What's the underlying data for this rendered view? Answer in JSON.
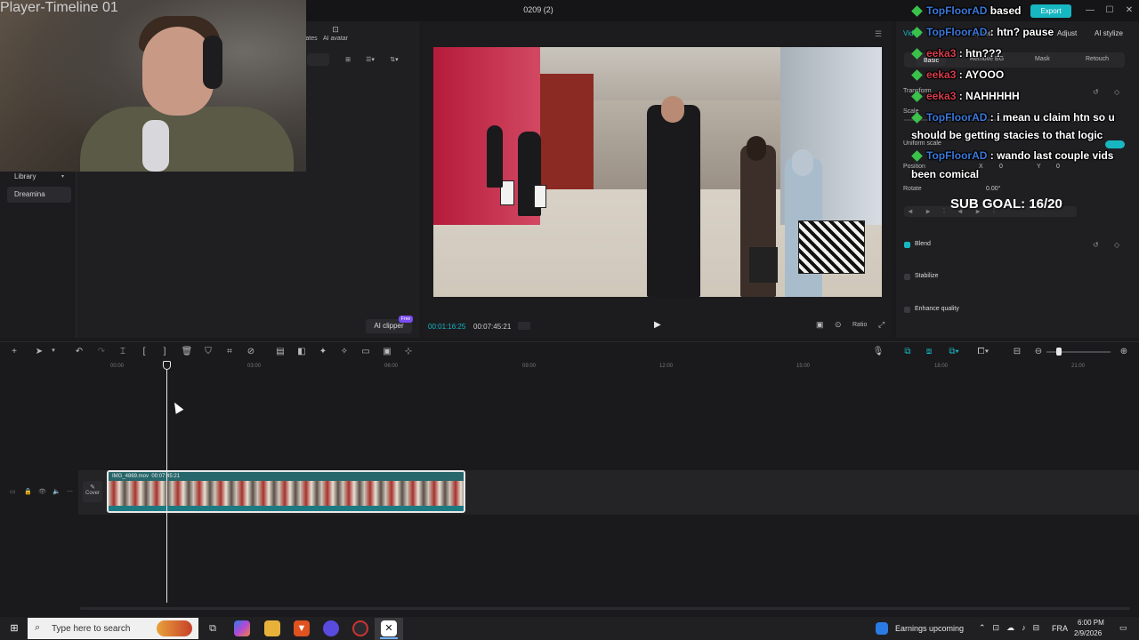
{
  "window": {
    "title": "0209 (2)",
    "export_label": "Export",
    "controls": [
      "—",
      "☐",
      "✕"
    ]
  },
  "left_panel": {
    "top_tabs": [
      "ates",
      "AI avatar"
    ],
    "sidebar": [
      {
        "label": "Library",
        "active": false
      },
      {
        "label": "Dreamina",
        "active": true
      }
    ],
    "ai_clipper_label": "AI clipper",
    "free_badge": "Free"
  },
  "player": {
    "title": "Player-Timeline 01",
    "current_time": "00:01:16:25",
    "total_time": "00:07:45:21",
    "ratio_label": "Ratio"
  },
  "inspector": {
    "main_tabs": [
      "Video",
      "Speed",
      "Adjust",
      "AI stylize"
    ],
    "sub_tabs": [
      {
        "label": "Basic",
        "active": true
      },
      {
        "label": "Remove BG",
        "active": false
      },
      {
        "label": "Mask",
        "active": false
      },
      {
        "label": "Retouch",
        "active": false
      }
    ],
    "transform_label": "Transform",
    "scale_label": "Scale",
    "scale_value": "100%",
    "uniform_scale_label": "Uniform scale",
    "position_label": "Position",
    "pos_x_label": "X",
    "pos_x_value": "0",
    "pos_y_label": "Y",
    "pos_y_value": "0",
    "rotate_label": "Rotate",
    "rotate_value": "0.00°",
    "blend_label": "Blend",
    "stabilize_label": "Stabilize",
    "enhance_label": "Enhance quality"
  },
  "chat": {
    "messages": [
      {
        "user": "TopFloorAD",
        "text": "based",
        "user_color": "blue"
      },
      {
        "user": "TopFloorAD",
        "text": "htn? pause",
        "user_color": "blue"
      },
      {
        "user": "eeka3",
        "text": "htn???",
        "user_color": "red"
      },
      {
        "user": "eeka3",
        "text": "AYOOO",
        "user_color": "red"
      },
      {
        "user": "eeka3",
        "text": "NAHHHHH",
        "user_color": "red"
      },
      {
        "user": "TopFloorAD",
        "text": "i mean u claim htn so u",
        "user_color": "blue"
      },
      {
        "user": "",
        "text": "should be getting stacies to that logic",
        "user_color": ""
      },
      {
        "user": "TopFloorAD",
        "text": "wando last couple vids",
        "user_color": "blue"
      },
      {
        "user": "",
        "text": "been comical",
        "user_color": ""
      }
    ],
    "sub_goal": "SUB GOAL: 16/20"
  },
  "timeline": {
    "ruler": [
      "00:00",
      "03:00",
      "06:00",
      "09:00",
      "12:00",
      "15:00",
      "18:00",
      "21:00"
    ],
    "clip_name": "IMG_4869.mov",
    "clip_duration": "00:07:45:21",
    "cover_label": "Cover"
  },
  "taskbar": {
    "search_placeholder": "Type here to search",
    "news_label": "Earnings upcoming",
    "language": "FRA",
    "time": "6:00 PM",
    "date": "2/9/2026"
  },
  "colors": {
    "accent": "#17b7c2",
    "chat_blue": "#3a78d9",
    "chat_red": "#d63c4c",
    "chat_diamond": "#3ac24a"
  }
}
